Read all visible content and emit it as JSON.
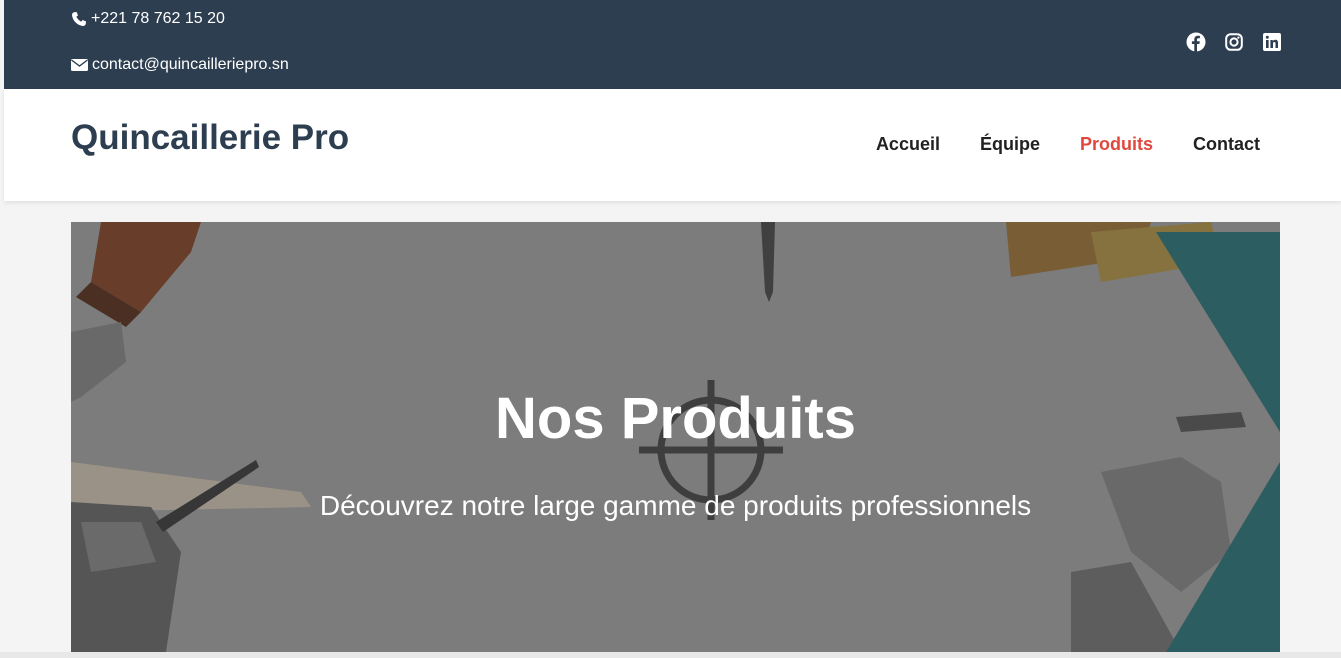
{
  "topbar": {
    "phone": "+221 78 762 15 20",
    "email": "contact@quincailleriepro.sn",
    "socials": [
      "facebook-icon",
      "instagram-icon",
      "linkedin-icon"
    ]
  },
  "header": {
    "brand": "Quincaillerie Pro",
    "nav": [
      {
        "label": "Accueil",
        "active": false
      },
      {
        "label": "Équipe",
        "active": false
      },
      {
        "label": "Produits",
        "active": true
      },
      {
        "label": "Contact",
        "active": false
      }
    ]
  },
  "hero": {
    "title": "Nos Produits",
    "subtitle": "Découvrez notre large gamme de produits professionnels"
  },
  "colors": {
    "topbar_bg": "#2d3e50",
    "brand": "#2d3e50",
    "nav_active": "#e0483e",
    "accent_teal": "#2e7a80"
  }
}
